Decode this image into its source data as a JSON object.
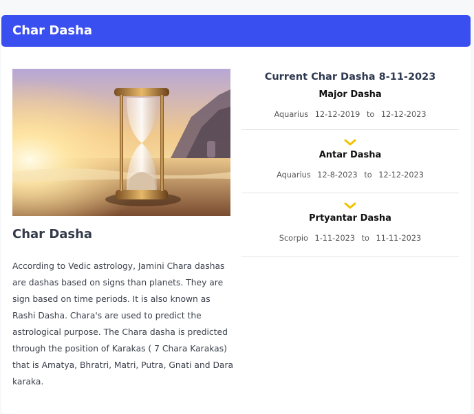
{
  "header": {
    "title": "Char Dasha"
  },
  "left": {
    "title": "Char Dasha",
    "description": "According to Vedic astrology, Jamini Chara dashas are dashas based on signs than planets. They are sign based on time periods. It is also known as Rashi Dasha. Chara's are used to predict the astrological purpose. The Chara dasha is predicted through the position of Karakas ( 7 Chara Karakas) that is Amatya, Bhratri, Matri, Putra, Gnati and Dara karaka."
  },
  "right": {
    "heading": "Current Char Dasha 8-11-2023",
    "blocks": [
      {
        "title": "Major Dasha",
        "sign": "Aquarius",
        "from": "12-12-2019",
        "to_word": "to",
        "to": "12-12-2023"
      },
      {
        "title": "Antar Dasha",
        "sign": "Aquarius",
        "from": "12-8-2023",
        "to_word": "to",
        "to": "12-12-2023"
      },
      {
        "title": "Prtyantar Dasha",
        "sign": "Scorpio",
        "from": "1-11-2023",
        "to_word": "to",
        "to": "11-11-2023"
      }
    ]
  },
  "colors": {
    "header_bg": "#3a4ff0",
    "chevron": "#f2c200"
  },
  "icons": {
    "hero": "hourglass-image",
    "expand": "chevron-down-icon"
  }
}
